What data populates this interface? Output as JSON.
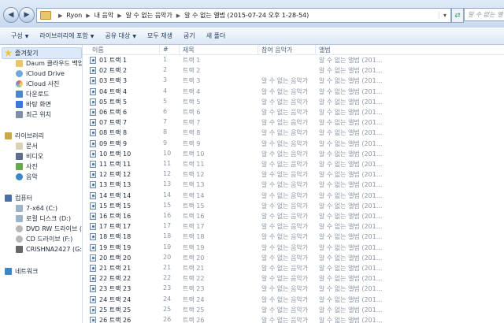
{
  "address": {
    "breadcrumbs": [
      "Ryon",
      "내 음악",
      "알 수 없는 음악가",
      "알 수 없는 앨범 (2015-07-24 오후 1-28-54)"
    ],
    "search_placeholder": "알 수 없는 앨범 (201..."
  },
  "toolbar": {
    "organize": "구성",
    "include_library": "라이브러리에 포함",
    "share": "공유 대상",
    "play_all": "모두 재생",
    "burn": "굽기",
    "new_folder": "새 폴더"
  },
  "nav": {
    "favorites_label": "즐겨찾기",
    "favorites": [
      "Daum 클라우드 백업",
      "iCloud Drive",
      "iCloud 사진",
      "다운로드",
      "바탕 화면",
      "최근 위치"
    ],
    "libraries_label": "라이브러리",
    "libraries": [
      "문서",
      "비디오",
      "사진",
      "음악"
    ],
    "computer_label": "컴퓨터",
    "drives": [
      "7-x64 (C:)",
      "로컬 디스크 (D:)",
      "DVD RW 드라이브 (E:)",
      "CD 드라이브 (F:)",
      "CRISHNA2427 (G:)"
    ],
    "network_label": "네트워크"
  },
  "columns": {
    "name": "이름",
    "number": "#",
    "title": "제목",
    "artists": "참여 음악가",
    "album": "앨범"
  },
  "files": [
    {
      "name": "01 트랙 1",
      "num": "1",
      "title": "트랙 1",
      "artist": "",
      "album": "알 수 없는 앨범 (201..."
    },
    {
      "name": "02 트랙 2",
      "num": "2",
      "title": "트랙 2",
      "artist": "",
      "album": "알 수 없는 앨범 (201..."
    },
    {
      "name": "03 트랙 3",
      "num": "3",
      "title": "트랙 3",
      "artist": "알 수 없는 음악가",
      "album": "알 수 없는 앨범 (201..."
    },
    {
      "name": "04 트랙 4",
      "num": "4",
      "title": "트랙 4",
      "artist": "알 수 없는 음악가",
      "album": "알 수 없는 앨범 (201..."
    },
    {
      "name": "05 트랙 5",
      "num": "5",
      "title": "트랙 5",
      "artist": "알 수 없는 음악가",
      "album": "알 수 없는 앨범 (201..."
    },
    {
      "name": "06 트랙 6",
      "num": "6",
      "title": "트랙 6",
      "artist": "알 수 없는 음악가",
      "album": "알 수 없는 앨범 (201..."
    },
    {
      "name": "07 트랙 7",
      "num": "7",
      "title": "트랙 7",
      "artist": "알 수 없는 음악가",
      "album": "알 수 없는 앨범 (201..."
    },
    {
      "name": "08 트랙 8",
      "num": "8",
      "title": "트랙 8",
      "artist": "알 수 없는 음악가",
      "album": "알 수 없는 앨범 (201..."
    },
    {
      "name": "09 트랙 9",
      "num": "9",
      "title": "트랙 9",
      "artist": "알 수 없는 음악가",
      "album": "알 수 없는 앨범 (201..."
    },
    {
      "name": "10 트랙 10",
      "num": "10",
      "title": "트랙 10",
      "artist": "알 수 없는 음악가",
      "album": "알 수 없는 앨범 (201..."
    },
    {
      "name": "11 트랙 11",
      "num": "11",
      "title": "트랙 11",
      "artist": "알 수 없는 음악가",
      "album": "알 수 없는 앨범 (201..."
    },
    {
      "name": "12 트랙 12",
      "num": "12",
      "title": "트랙 12",
      "artist": "알 수 없는 음악가",
      "album": "알 수 없는 앨범 (201..."
    },
    {
      "name": "13 트랙 13",
      "num": "13",
      "title": "트랙 13",
      "artist": "알 수 없는 음악가",
      "album": "알 수 없는 앨범 (201..."
    },
    {
      "name": "14 트랙 14",
      "num": "14",
      "title": "트랙 14",
      "artist": "알 수 없는 음악가",
      "album": "알 수 없는 앨범 (201..."
    },
    {
      "name": "15 트랙 15",
      "num": "15",
      "title": "트랙 15",
      "artist": "알 수 없는 음악가",
      "album": "알 수 없는 앨범 (201..."
    },
    {
      "name": "16 트랙 16",
      "num": "16",
      "title": "트랙 16",
      "artist": "알 수 없는 음악가",
      "album": "알 수 없는 앨범 (201..."
    },
    {
      "name": "17 트랙 17",
      "num": "17",
      "title": "트랙 17",
      "artist": "알 수 없는 음악가",
      "album": "알 수 없는 앨범 (201..."
    },
    {
      "name": "18 트랙 18",
      "num": "18",
      "title": "트랙 18",
      "artist": "알 수 없는 음악가",
      "album": "알 수 없는 앨범 (201..."
    },
    {
      "name": "19 트랙 19",
      "num": "19",
      "title": "트랙 19",
      "artist": "알 수 없는 음악가",
      "album": "알 수 없는 앨범 (201..."
    },
    {
      "name": "20 트랙 20",
      "num": "20",
      "title": "트랙 20",
      "artist": "알 수 없는 음악가",
      "album": "알 수 없는 앨범 (201..."
    },
    {
      "name": "21 트랙 21",
      "num": "21",
      "title": "트랙 21",
      "artist": "알 수 없는 음악가",
      "album": "알 수 없는 앨범 (201..."
    },
    {
      "name": "22 트랙 22",
      "num": "22",
      "title": "트랙 22",
      "artist": "알 수 없는 음악가",
      "album": "알 수 없는 앨범 (201..."
    },
    {
      "name": "23 트랙 23",
      "num": "23",
      "title": "트랙 23",
      "artist": "알 수 없는 음악가",
      "album": "알 수 없는 앨범 (201..."
    },
    {
      "name": "24 트랙 24",
      "num": "24",
      "title": "트랙 24",
      "artist": "알 수 없는 음악가",
      "album": "알 수 없는 앨범 (201..."
    },
    {
      "name": "25 트랙 25",
      "num": "25",
      "title": "트랙 25",
      "artist": "알 수 없는 음악가",
      "album": "알 수 없는 앨범 (201..."
    },
    {
      "name": "26 트랙 26",
      "num": "26",
      "title": "트랙 26",
      "artist": "알 수 없는 음악가",
      "album": "알 수 없는 앨범 (201..."
    }
  ],
  "colors": {
    "folder": "#e9c66a",
    "selection": "#dce9f8",
    "text_dim": "#8b95a3"
  }
}
